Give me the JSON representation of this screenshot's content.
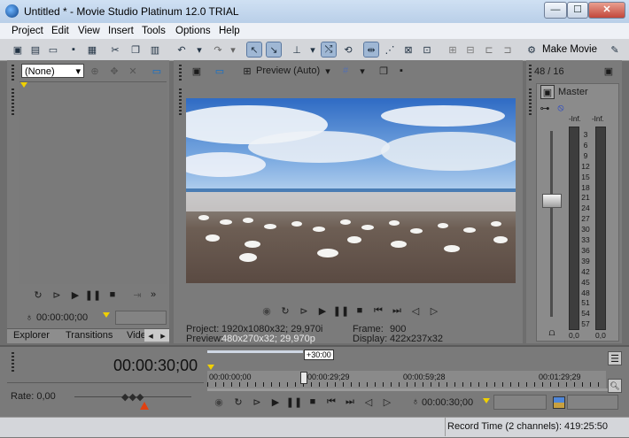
{
  "window": {
    "title": "Untitled * - Movie Studio Platinum 12.0 TRIAL",
    "minimize": "—",
    "maximize": "☐",
    "close": "✕"
  },
  "menu": [
    "Project",
    "Edit",
    "View",
    "Insert",
    "Tools",
    "Options",
    "Help"
  ],
  "toolbar": {
    "make_movie": "Make Movie"
  },
  "left_panel": {
    "dropdown_value": "(None)",
    "timecode": "00:00:00;00",
    "tabs": [
      "Explorer",
      "Transitions",
      "Vide"
    ]
  },
  "preview": {
    "mode_label": "Preview (Auto)",
    "project_label": "Project:",
    "project_value": "1920x1080x32; 29,970i",
    "preview_label": "Preview:",
    "preview_value": "480x270x32; 29,970p",
    "frame_label": "Frame:",
    "frame_value": "900",
    "display_label": "Display:",
    "display_value": "422x237x32"
  },
  "mixer": {
    "channels": "48 / 16",
    "master_label": "Master",
    "left_peak": "-Inf.",
    "right_peak": "-Inf.",
    "scale": [
      "3",
      "6",
      "9",
      "12",
      "15",
      "18",
      "21",
      "24",
      "27",
      "30",
      "33",
      "36",
      "39",
      "42",
      "45",
      "48",
      "51",
      "54",
      "57"
    ],
    "left_value": "0,0",
    "right_value": "0,0"
  },
  "timeline": {
    "current_time": "00:00:30;00",
    "rate": "Rate: 0,00",
    "loop_marker": "+30:00",
    "ruler": [
      "00:00:00;00",
      "00:00:29;29",
      "00:00:59;28",
      "00:01:29;29"
    ],
    "bottom_time": "00:00:30;00"
  },
  "status": {
    "record": "Record Time (2 channels): 419:25:50"
  },
  "colors": {
    "panel": "#7b7b7b",
    "titlebar": "#c4d7ee",
    "accent": "#f0d000"
  }
}
